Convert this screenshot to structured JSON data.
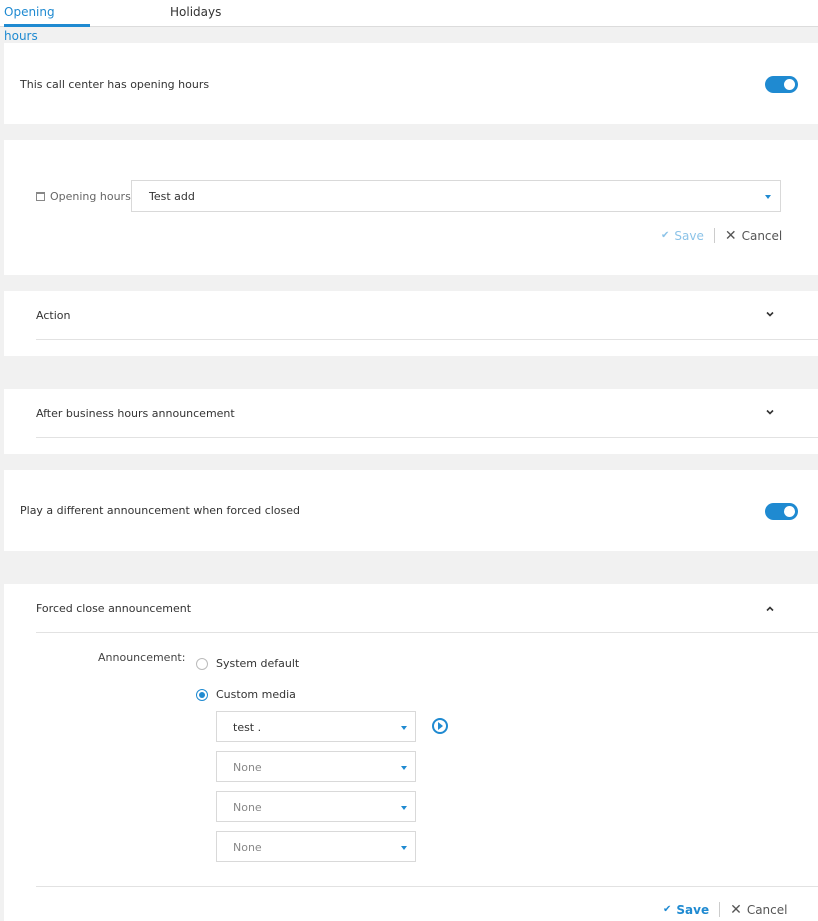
{
  "tabs": [
    {
      "label": "Opening hours",
      "active": true
    },
    {
      "label": "Holidays",
      "active": false
    }
  ],
  "opening_hours_toggle": {
    "label": "This call center has opening hours",
    "on": true
  },
  "opening_hours_select": {
    "label": "Opening hours",
    "value": "Test add"
  },
  "actions_top": {
    "save": "Save",
    "cancel": "Cancel"
  },
  "sections": {
    "action": "Action",
    "after_hours": "After business hours announcement",
    "forced_close": "Forced close announcement"
  },
  "forced_closed_toggle": {
    "label": "Play a different announcement when forced closed",
    "on": true
  },
  "announcement": {
    "label": "Announcement:",
    "options": [
      "System default",
      "Custom media"
    ],
    "selected": "Custom media",
    "media": [
      "test .",
      "None",
      "None",
      "None"
    ]
  },
  "actions_bottom": {
    "save": "Save",
    "cancel": "Cancel"
  },
  "colors": {
    "accent": "#1f8ad1",
    "background": "#f1f1f1",
    "card": "#ffffff"
  }
}
